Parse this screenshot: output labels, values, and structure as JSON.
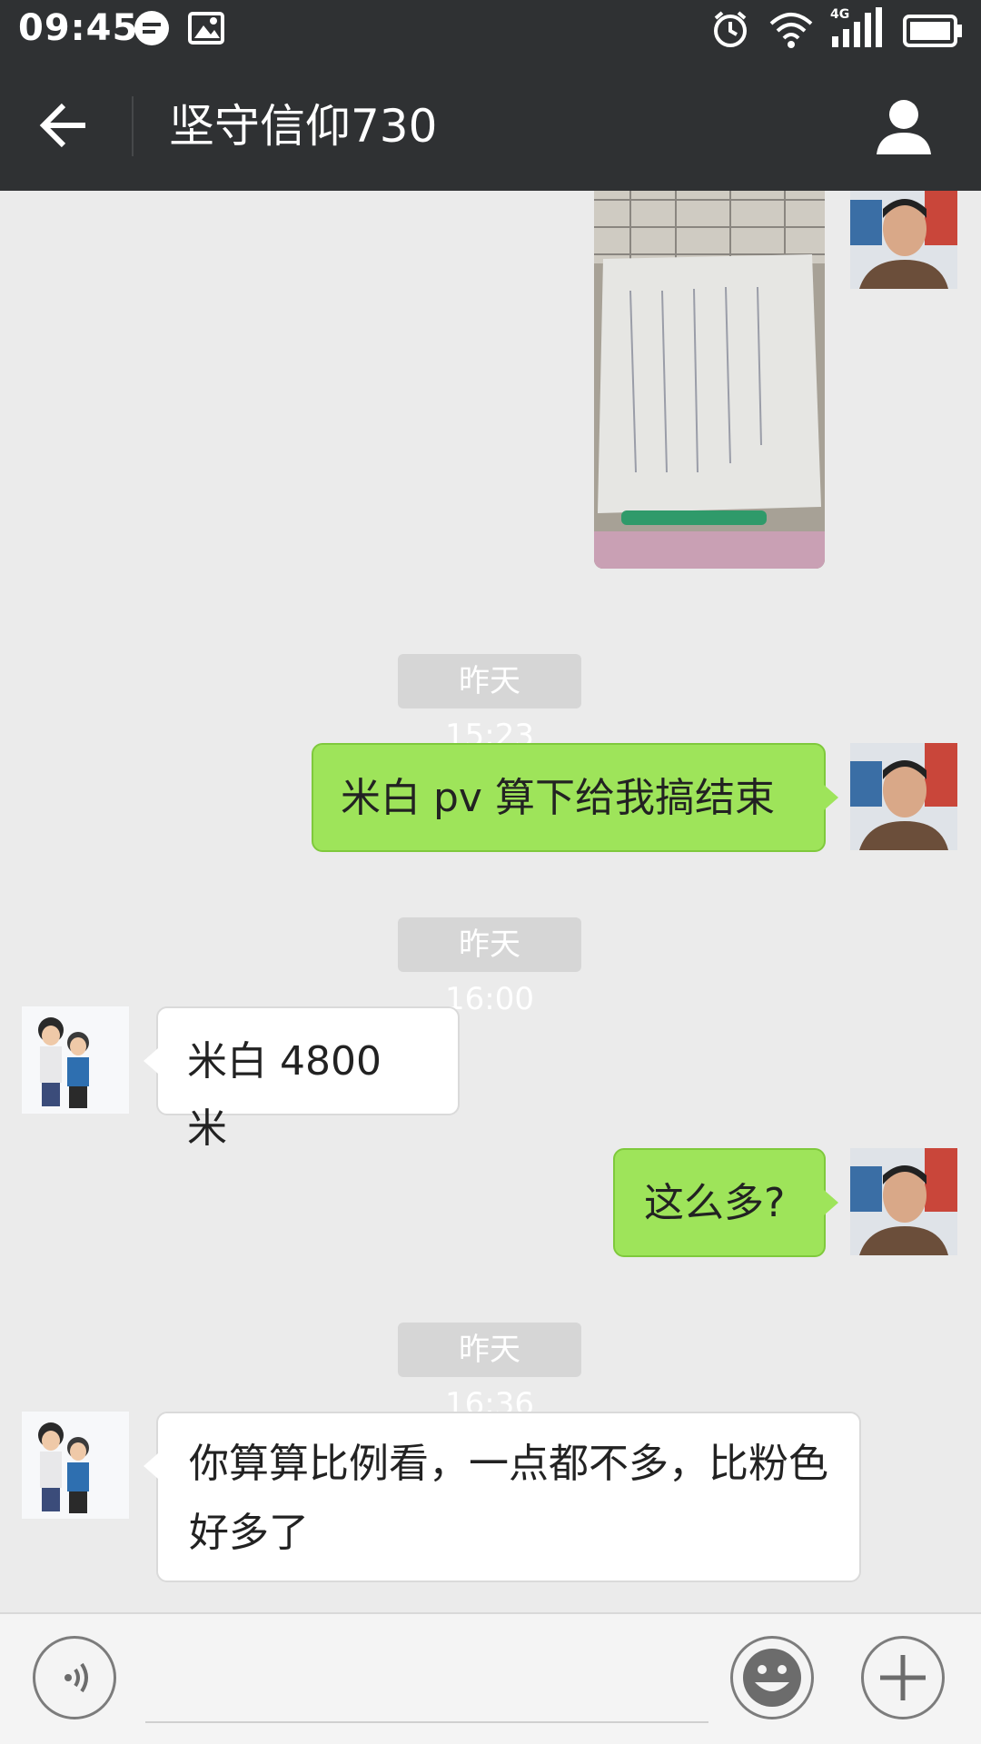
{
  "status_bar": {
    "time": "09:45",
    "icons": [
      "chat-notification-icon",
      "image-notification-icon",
      "alarm-icon",
      "wifi-icon",
      "cellular-4g-icon",
      "battery-icon"
    ],
    "network_label": "4G"
  },
  "app_bar": {
    "title": "坚守信仰730",
    "back_icon": "arrow-left-icon",
    "profile_icon": "person-icon"
  },
  "messages": [
    {
      "type": "image",
      "sender": "me"
    },
    {
      "type": "timestamp",
      "text": "昨天 15:23"
    },
    {
      "type": "text",
      "sender": "me",
      "text": "米白 pv 算下给我搞结束"
    },
    {
      "type": "timestamp",
      "text": "昨天 16:00"
    },
    {
      "type": "text",
      "sender": "other",
      "text": "米白 4800 米"
    },
    {
      "type": "text",
      "sender": "me",
      "text": "这么多?"
    },
    {
      "type": "timestamp",
      "text": "昨天 16:36"
    },
    {
      "type": "text",
      "sender": "other",
      "text": "你算算比例看，一点都不多，比粉色好多了"
    }
  ],
  "input_bar": {
    "voice_icon": "voice-icon",
    "emoji_icon": "emoji-icon",
    "more_icon": "plus-icon",
    "input_value": ""
  },
  "colors": {
    "header": "#2f3133",
    "chat_background": "#ebebeb",
    "my_bubble": "#9ee45a",
    "other_bubble": "#ffffff",
    "timestamp_pill": "#d6d6d6"
  }
}
